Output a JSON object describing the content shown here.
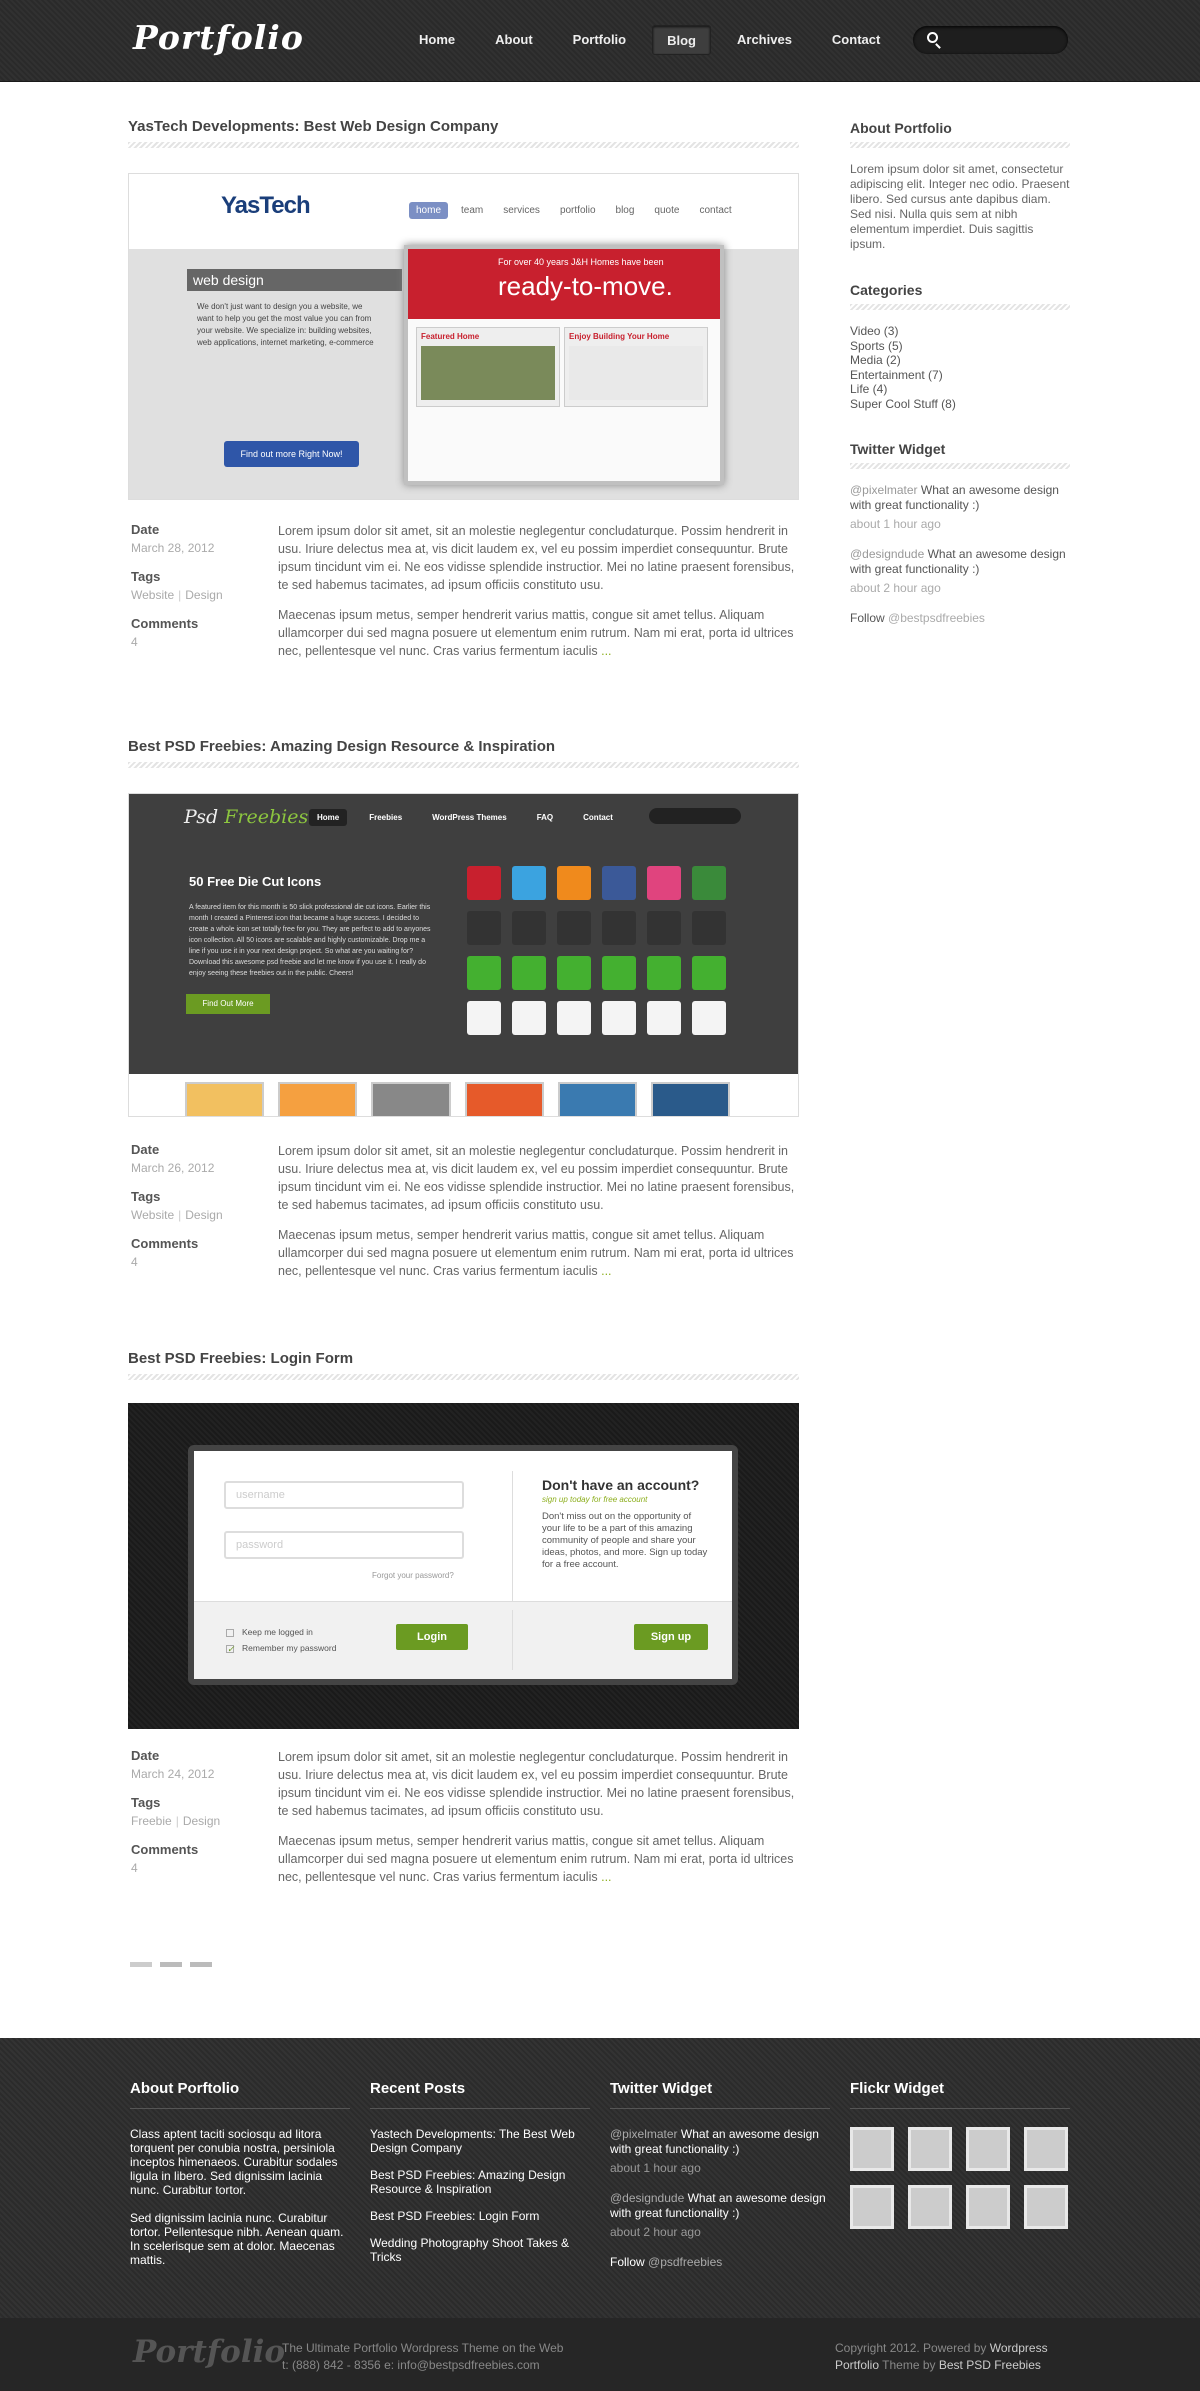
{
  "header": {
    "logo": "Portfolio",
    "nav": [
      "Home",
      "About",
      "Portfolio",
      "Blog",
      "Archives",
      "Contact"
    ],
    "active_nav": "Blog",
    "search_placeholder": ""
  },
  "posts": [
    {
      "title": "YasTech Developments: Best Web Design Company",
      "date_label": "Date",
      "date": "March 28, 2012",
      "tags_label": "Tags",
      "tags": [
        "Website",
        "Design"
      ],
      "comments_label": "Comments",
      "comments": "4",
      "para1": "Lorem ipsum dolor sit amet, sit an molestie neglegentur concludaturque. Possim hendrerit in usu. Iriure delectus mea at, vis dicit laudem ex, vel eu possim imperdiet consequuntur. Brute ipsum tincidunt vim ei. Ne eos vidisse splendide instructior. Mei no latine praesent forensibus, te sed habemus tacimates, ad ipsum officiis constituto usu.",
      "para2": "Maecenas ipsum metus, semper hendrerit varius mattis, congue sit amet tellus. Aliquam ullamcorper dui sed magna posuere ut elementum enim rutrum. Nam mi erat, porta id ultrices nec, pellentesque vel nunc. Cras varius fermentum iaculis",
      "more": "...",
      "image": {
        "logo": "YasTech",
        "nav": [
          "home",
          "team",
          "services",
          "portfolio",
          "blog",
          "quote",
          "contact"
        ],
        "heading": "web design",
        "text": "We don't just want to design you a website, we want to help you get the most value you can from your website. We specialize in: building websites, web applications, internet marketing, e-commerce",
        "button": "Find out more Right Now!",
        "banner_small": "For over 40 years J&H Homes have been",
        "banner_big": "ready-to-move.",
        "tiles": [
          "Featured Home",
          "Enjoy Building Your Home"
        ]
      }
    },
    {
      "title": "Best PSD Freebies: Amazing Design Resource & Inspiration",
      "date_label": "Date",
      "date": "March 26, 2012",
      "tags_label": "Tags",
      "tags": [
        "Website",
        "Design"
      ],
      "comments_label": "Comments",
      "comments": "4",
      "para1": "Lorem ipsum dolor sit amet, sit an molestie neglegentur concludaturque. Possim hendrerit in usu. Iriure delectus mea at, vis dicit laudem ex, vel eu possim imperdiet consequuntur. Brute ipsum tincidunt vim ei. Ne eos vidisse splendide instructior. Mei no latine praesent forensibus, te sed habemus tacimates, ad ipsum officiis constituto usu.",
      "para2": "Maecenas ipsum metus, semper hendrerit varius mattis, congue sit amet tellus. Aliquam ullamcorper dui sed magna posuere ut elementum enim rutrum. Nam mi erat, porta id ultrices nec, pellentesque vel nunc. Cras varius fermentum iaculis",
      "more": "...",
      "image": {
        "logo_a": "Psd",
        "logo_b": "Freebies",
        "nav": [
          "Home",
          "Freebies",
          "WordPress Themes",
          "FAQ",
          "Contact"
        ],
        "heading": "50 Free Die Cut Icons",
        "text": "A featured item for this month is 50 slick professional die cut icons. Earlier this month I created a Pinterest icon that became a huge success. I decided to create a whole icon set totally free for you. They are perfect to add to anyones icon collection. All 50 icons are scalable and highly customizable. Drop me a line if you use it in your next design project. So what are you waiting for? Download this awesome psd freebie and let me know if you use it. I really do enjoy seeing these freebies out in the public. Cheers!",
        "button": "Find Out More",
        "icon_colors": [
          "#c8202e",
          "#3ba3e0",
          "#f08a1c",
          "#3b5998",
          "#e0447e",
          "#3a8a3a",
          "#333",
          "#333",
          "#333",
          "#333",
          "#333",
          "#333",
          "#44b030",
          "#44b030",
          "#44b030",
          "#44b030",
          "#44b030",
          "#44b030",
          "#f4f4f4",
          "#f4f4f4",
          "#f4f4f4",
          "#f4f4f4",
          "#f4f4f4",
          "#f4f4f4"
        ]
      }
    },
    {
      "title": "Best PSD Freebies: Login Form",
      "date_label": "Date",
      "date": "March 24, 2012",
      "tags_label": "Tags",
      "tags": [
        "Freebie",
        "Design"
      ],
      "comments_label": "Comments",
      "comments": "4",
      "para1": "Lorem ipsum dolor sit amet, sit an molestie neglegentur concludaturque. Possim hendrerit in usu. Iriure delectus mea at, vis dicit laudem ex, vel eu possim imperdiet consequuntur. Brute ipsum tincidunt vim ei. Ne eos vidisse splendide instructior. Mei no latine praesent forensibus, te sed habemus tacimates, ad ipsum officiis constituto usu.",
      "para2": "Maecenas ipsum metus, semper hendrerit varius mattis, congue sit amet tellus. Aliquam ullamcorper dui sed magna posuere ut elementum enim rutrum. Nam mi erat, porta id ultrices nec, pellentesque vel nunc. Cras varius fermentum iaculis",
      "more": "...",
      "image": {
        "username": "username",
        "password": "password",
        "forgot": "Forgot your password?",
        "keep": "Keep me logged in",
        "remember": "Remember my password",
        "login": "Login",
        "heading": "Don't have an account?",
        "sub": "sign up today for free account",
        "text": "Don't miss out on the opportunity of your life to be a part of this amazing community of people and share your ideas, photos, and more. Sign up today for a free account.",
        "signup": "Sign up"
      }
    }
  ],
  "sidebar": {
    "about_title": "About Portfolio",
    "about_text": "Lorem ipsum dolor sit amet, consectetur adipiscing elit. Integer nec odio. Praesent libero. Sed cursus ante dapibus diam. Sed nisi. Nulla quis sem at nibh elementum imperdiet. Duis sagittis ipsum.",
    "categories_title": "Categories",
    "categories": [
      "Video (3)",
      "Sports (5)",
      "Media (2)",
      "Entertainment (7)",
      "Life (4)",
      "Super Cool Stuff (8)"
    ],
    "twitter_title": "Twitter Widget",
    "tweets": [
      {
        "user": "@pixelmater",
        "text": "What an awesome design with great functionality :)",
        "time": "about 1 hour ago"
      },
      {
        "user": "@designdude",
        "text": "What an awesome design with great functionality :)",
        "time": "about 2 hour ago"
      }
    ],
    "follow_label": "Follow",
    "follow_user": "@bestpsdfreebies"
  },
  "footer": {
    "about_title": "About Porftolio",
    "about_p1": "Class aptent taciti sociosqu ad litora torquent per conubia nostra, persiniola inceptos himenaeos. Curabitur sodales ligula in libero. Sed dignissim lacinia nunc. Curabitur tortor.",
    "about_p2": "Sed dignissim lacinia nunc. Curabitur tortor. Pellentesque nibh. Aenean quam. In scelerisque sem at dolor. Maecenas mattis.",
    "recent_title": "Recent Posts",
    "recent": [
      "Yastech Developments: The Best Web Design Company",
      "Best PSD Freebies: Amazing Design Resource & Inspiration",
      "Best PSD Freebies: Login Form",
      "Wedding Photography Shoot Takes & Tricks"
    ],
    "twitter_title": "Twitter Widget",
    "tweets": [
      {
        "user": "@pixelmater",
        "text": "What an awesome design with great functionality :)",
        "time": "about 1 hour ago"
      },
      {
        "user": "@designdude",
        "text": "What an awesome design with great functionality :)",
        "time": "about 2 hour ago"
      }
    ],
    "follow_label": "Follow",
    "follow_user": "@psdfreebies",
    "flickr_title": "Flickr Widget",
    "bottom_logo": "Portfolio",
    "tagline": "The Ultimate Portfolio  Wordpress Theme on the Web",
    "contact": "t: (888) 842 - 8356  e: info@bestpsdfreebies.com",
    "copy1a": "Copyright 2012. Powered by ",
    "copy1b": "Wordpress",
    "copy2a": "Portfolio",
    "copy2b": " Theme by ",
    "copy2c": "Best PSD Freebies"
  }
}
